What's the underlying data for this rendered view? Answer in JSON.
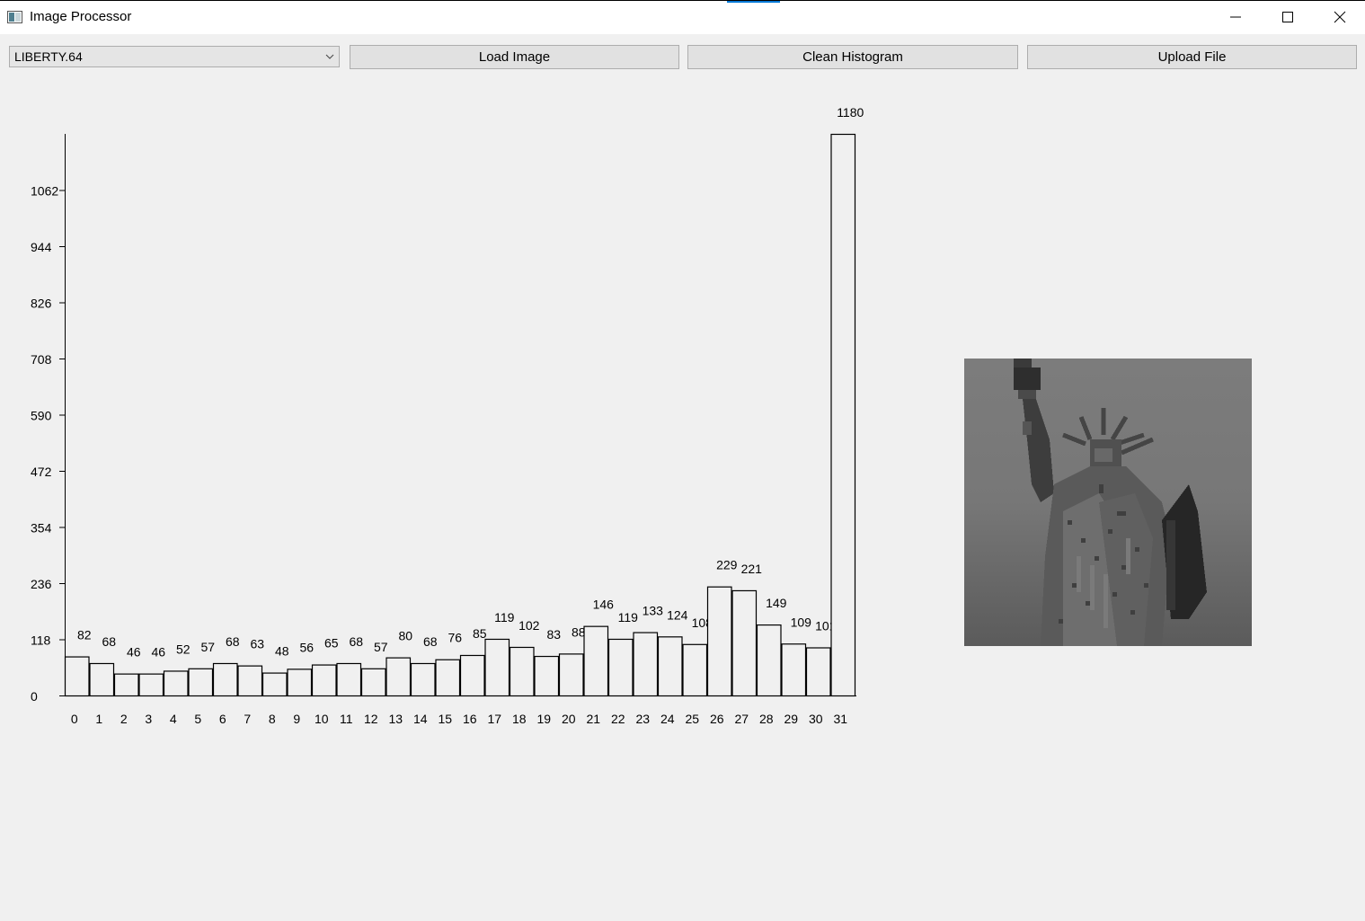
{
  "window": {
    "title": "Image Processor",
    "icon": "app-window-icon",
    "controls": [
      "minimize-icon",
      "maximize-icon",
      "close-icon"
    ]
  },
  "toolbar": {
    "image_select": {
      "selected": "LIBERTY.64"
    },
    "load_label": "Load Image",
    "clean_label": "Clean Histogram",
    "upload_label": "Upload File"
  },
  "colors": {
    "background": "#f0f0f0",
    "bar_fill": "#f0f0f0",
    "bar_stroke": "#000000",
    "accent": "#0078d7"
  },
  "preview": {
    "icon": "statue-of-liberty-image"
  },
  "chart_data": {
    "type": "bar",
    "categories": [
      "0",
      "1",
      "2",
      "3",
      "4",
      "5",
      "6",
      "7",
      "8",
      "9",
      "10",
      "11",
      "12",
      "13",
      "14",
      "15",
      "16",
      "17",
      "18",
      "19",
      "20",
      "21",
      "22",
      "23",
      "24",
      "25",
      "26",
      "27",
      "28",
      "29",
      "30",
      "31"
    ],
    "values": [
      82,
      68,
      46,
      46,
      52,
      57,
      68,
      63,
      48,
      56,
      65,
      68,
      57,
      80,
      68,
      76,
      85,
      119,
      102,
      83,
      88,
      146,
      119,
      133,
      124,
      108,
      229,
      221,
      149,
      109,
      101,
      1180
    ],
    "yticks": [
      0,
      118,
      236,
      354,
      472,
      590,
      708,
      826,
      944,
      1062
    ],
    "ylim": [
      0,
      1180
    ],
    "grid": false,
    "legend": "none",
    "title": "",
    "xlabel": "",
    "ylabel": ""
  }
}
